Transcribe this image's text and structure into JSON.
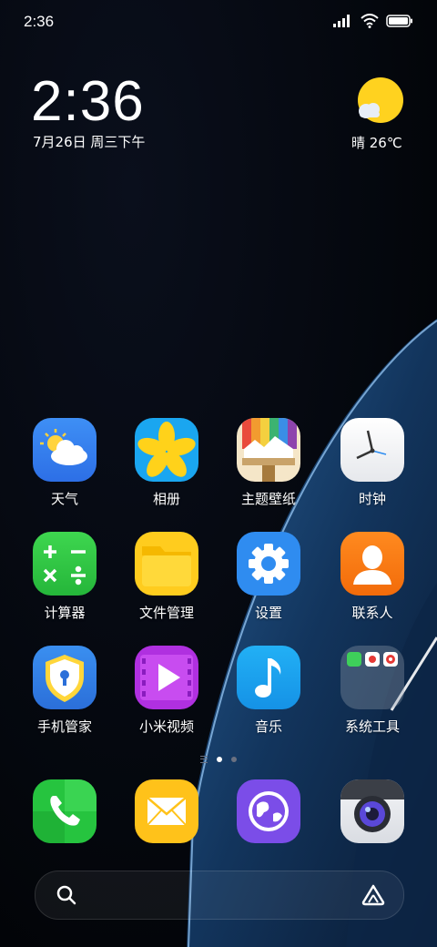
{
  "status_bar": {
    "time": "2:36"
  },
  "lockclock": {
    "time": "2:36",
    "date": "7月26日 周三下午"
  },
  "weather": {
    "text": "晴 26℃"
  },
  "apps": [
    {
      "label": "天气",
      "icon": "weather-icon"
    },
    {
      "label": "相册",
      "icon": "gallery-icon"
    },
    {
      "label": "主题壁纸",
      "icon": "themes-icon"
    },
    {
      "label": "时钟",
      "icon": "clock-icon"
    },
    {
      "label": "计算器",
      "icon": "calculator-icon"
    },
    {
      "label": "文件管理",
      "icon": "folder-icon"
    },
    {
      "label": "设置",
      "icon": "gear-icon"
    },
    {
      "label": "联系人",
      "icon": "contacts-icon"
    },
    {
      "label": "手机管家",
      "icon": "security-shield-icon"
    },
    {
      "label": "小米视频",
      "icon": "video-play-icon"
    },
    {
      "label": "音乐",
      "icon": "music-note-icon"
    },
    {
      "label": "系统工具",
      "icon": "folder-group-icon"
    }
  ],
  "dock": [
    {
      "icon": "phone-icon"
    },
    {
      "icon": "mail-icon"
    },
    {
      "icon": "browser-globe-icon"
    },
    {
      "icon": "camera-icon"
    }
  ],
  "page_indicator": {
    "count": 2,
    "active": 1
  },
  "colors": {
    "weather_sun": "#FFD21F",
    "settings_blue": "#2F8CF0",
    "video_purple": "#B030E0"
  }
}
